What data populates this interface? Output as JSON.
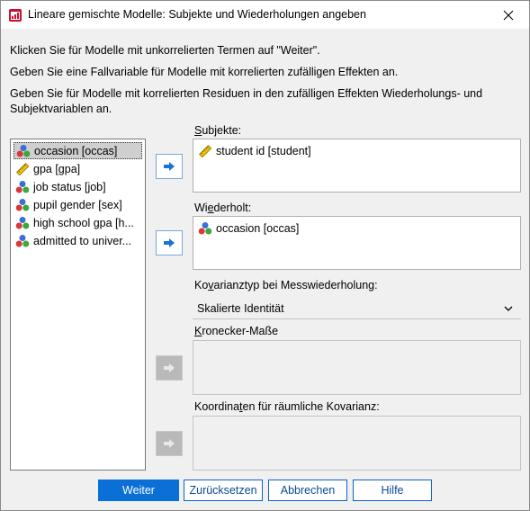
{
  "window": {
    "title": "Lineare gemischte Modelle: Subjekte und Wiederholungen angeben"
  },
  "instructions": {
    "line1": "Klicken Sie für Modelle mit unkorrelierten Termen auf \"Weiter\".",
    "line2": "Geben Sie eine Fallvariable für Modelle mit korrelierten zufälligen Effekten an.",
    "line3": "Geben Sie für Modelle mit korrelierten Residuen in den zufälligen Effekten Wiederholungs- und Subjektvariablen an."
  },
  "source_variables": [
    {
      "label": "occasion [occas]",
      "icon": "nominal-icon",
      "selected": true
    },
    {
      "label": "gpa [gpa]",
      "icon": "scale-ruler-icon",
      "selected": false
    },
    {
      "label": "job status [job]",
      "icon": "nominal-icon",
      "selected": false
    },
    {
      "label": "pupil gender [sex]",
      "icon": "nominal-icon",
      "selected": false
    },
    {
      "label": "high school gpa [h...",
      "icon": "nominal-icon",
      "selected": false
    },
    {
      "label": "admitted to univer...",
      "icon": "nominal-icon",
      "selected": false
    }
  ],
  "subjects": {
    "label_prefix": "",
    "label_mnemonic": "S",
    "label_rest": "ubjekte:",
    "items": [
      {
        "label": "student id [student]",
        "icon": "scale-ruler-icon"
      }
    ]
  },
  "repeated": {
    "label_prefix": "Wi",
    "label_mnemonic": "e",
    "label_rest": "derholt:",
    "items": [
      {
        "label": "occasion [occas]",
        "icon": "nominal-icon"
      }
    ]
  },
  "covariance_type": {
    "label_prefix": "Ko",
    "label_mnemonic": "v",
    "label_rest": "arianztyp bei Messwiederholung:",
    "selected": "Skalierte Identität"
  },
  "kronecker": {
    "label_prefix": "",
    "label_mnemonic": "K",
    "label_rest": "ronecker-Maße"
  },
  "spatial": {
    "label_prefix": "Koordina",
    "label_mnemonic": "t",
    "label_rest": "en für räumliche Kovarianz:"
  },
  "buttons": {
    "continue": "Weiter",
    "reset": "Zurücksetzen",
    "cancel": "Abbrechen",
    "help": "Hilfe"
  },
  "colors": {
    "accent": "#0b6fd8",
    "arrow": "#1a73d6",
    "disabled_arrow": "#b9b9b9"
  }
}
